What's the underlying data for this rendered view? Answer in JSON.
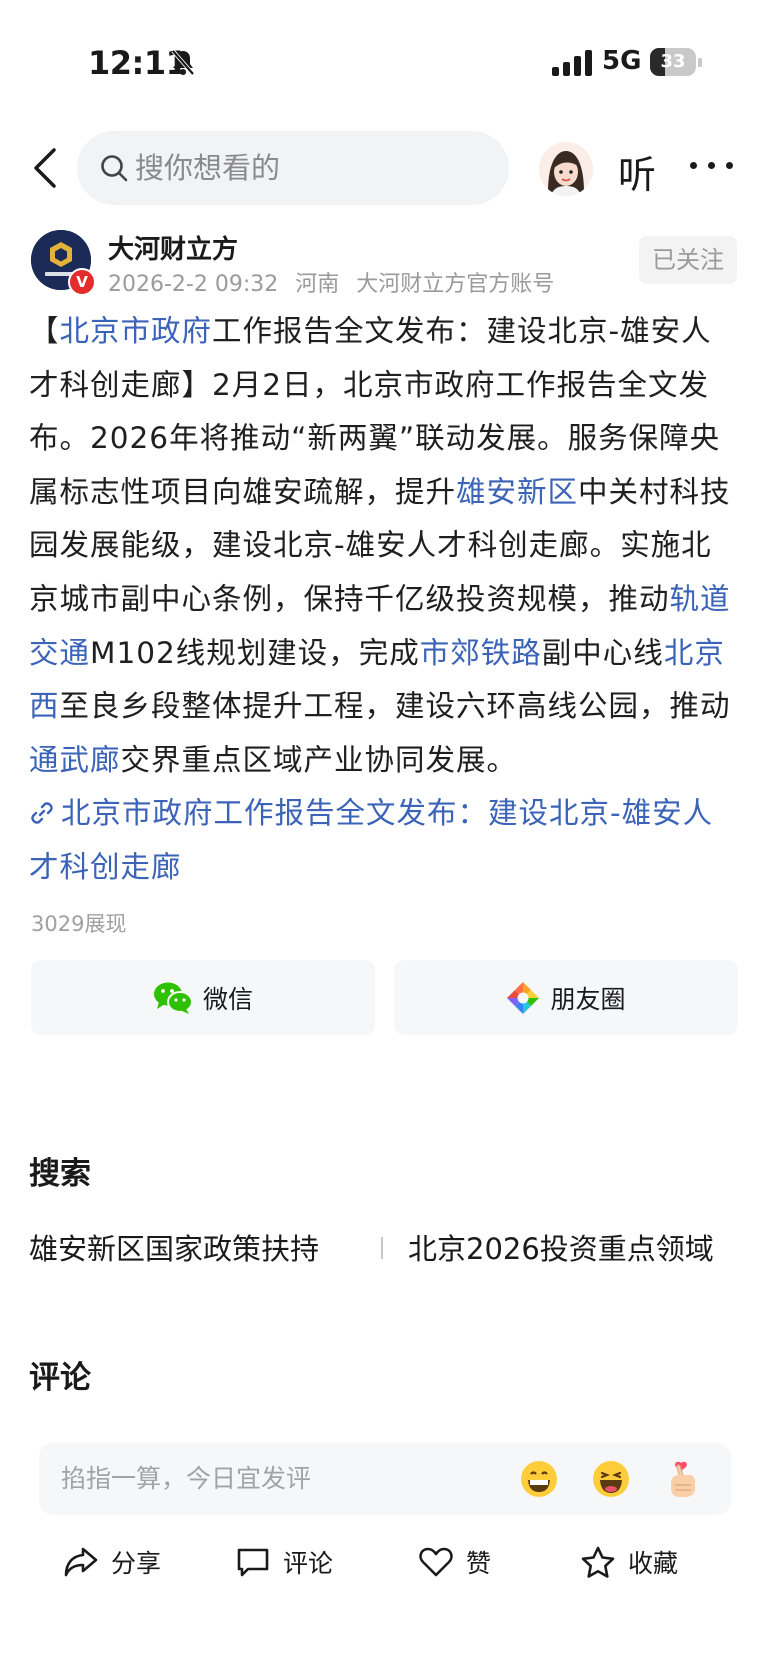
{
  "status_bar": {
    "time": "12:11",
    "network": "5G",
    "battery": "33",
    "battery_level": 0.33
  },
  "nav": {
    "search_placeholder": "搜你想看的",
    "listen_label": "听"
  },
  "author": {
    "name": "大河财立方",
    "date": "2026-2-2 09:32",
    "region": "河南",
    "account_type": "大河财立方官方账号",
    "follow_label": "已关注",
    "verified_badge": "V"
  },
  "article": {
    "segments": [
      {
        "text": "【",
        "link": false
      },
      {
        "text": "北京市政府",
        "link": true
      },
      {
        "text": "工作报告全文发布：建设北京-雄安人才科创走廊】2月2日，北京市政府工作报告全文发布。2026年将推动“新两翼”联动发展。服务保障央属标志性项目向雄安疏解，提升",
        "link": false
      },
      {
        "text": "雄安新区",
        "link": true
      },
      {
        "text": "中关村科技园发展能级，建设北京-雄安人才科创走廊。实施北京城市副中心条例，保持千亿级投资规模，推动",
        "link": false
      },
      {
        "text": "轨道交通",
        "link": true
      },
      {
        "text": "M102线规划建设，完成",
        "link": false
      },
      {
        "text": "市郊铁路",
        "link": true
      },
      {
        "text": "副中心线",
        "link": false
      },
      {
        "text": "北京西",
        "link": true
      },
      {
        "text": "至良乡段整体提升工程，建设六环高线公园，推动",
        "link": false
      },
      {
        "text": "通武廊",
        "link": true
      },
      {
        "text": "交界重点区域产业协同发展。",
        "link": false
      }
    ],
    "source_link": "北京市政府工作报告全文发布：建设北京-雄安人才科创走廊",
    "views": "3029展现"
  },
  "share": {
    "wechat_label": "微信",
    "moments_label": "朋友圈"
  },
  "search_section": {
    "title": "搜索",
    "suggestions": [
      "雄安新区国家政策扶持",
      "北京2026投资重点领域"
    ]
  },
  "comments": {
    "title": "评论",
    "placeholder": "掐指一算，今日宜发评",
    "emojis": [
      "grinning-face-icon",
      "laughing-face-icon",
      "finger-heart-icon"
    ]
  },
  "bottom_bar": {
    "share_label": "分享",
    "comment_label": "评论",
    "like_label": "赞",
    "favorite_label": "收藏"
  },
  "colors": {
    "link": "#3b63b8",
    "wechat_green": "#2dc100",
    "badge_red": "#e32d2d"
  }
}
